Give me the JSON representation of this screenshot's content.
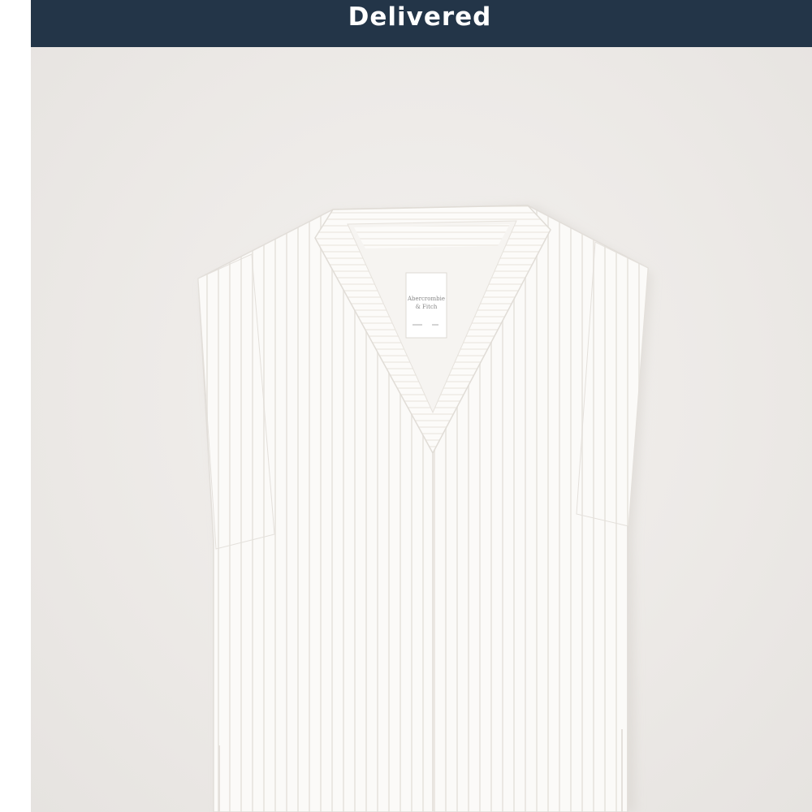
{
  "order": {
    "status_label": "Delivered"
  },
  "product": {
    "image_description_icon": "white-ribbed-v-neck-sweater-vest",
    "label_brand_text": "Abercrombie & Fitch"
  },
  "colors": {
    "banner": "#233548",
    "background": "#ece9e6",
    "garment": "#fbfaf8"
  }
}
